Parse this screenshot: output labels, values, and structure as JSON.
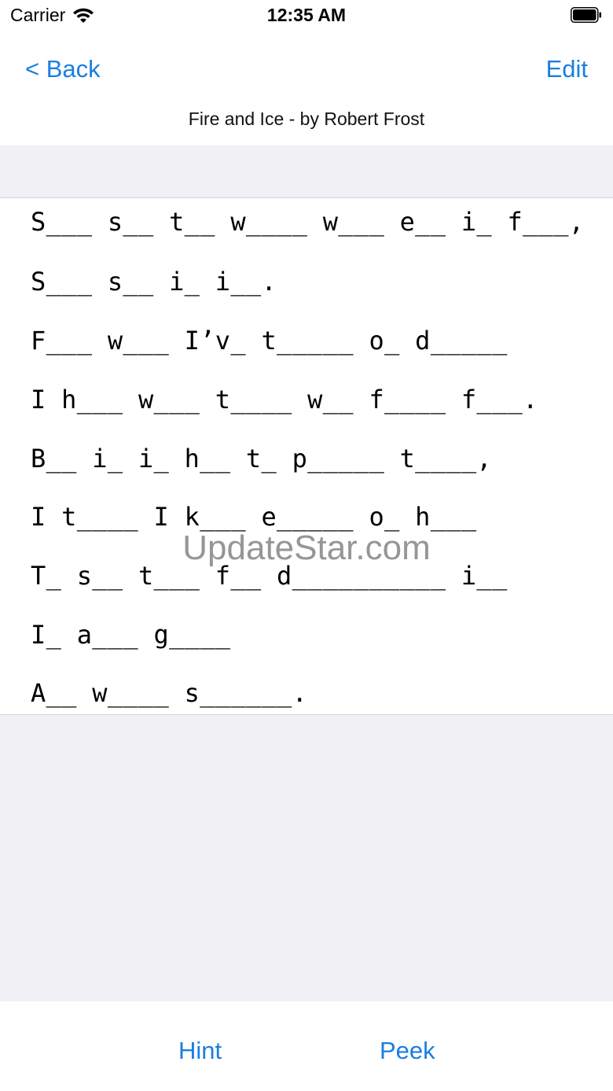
{
  "status_bar": {
    "carrier": "Carrier",
    "time": "12:35 AM",
    "wifi_icon": "wifi-icon",
    "battery_icon": "battery-icon"
  },
  "nav": {
    "back_label": "< Back",
    "edit_label": "Edit",
    "title": "Fire and Ice - by Robert Frost"
  },
  "poem": {
    "lines": [
      "S___ s__ t__ w____ w___ e__ i_ f___,",
      "S___ s__ i_ i__.",
      "F___ w___ I’v_ t_____ o_ d_____",
      "I h___ w___ t____ w__ f____ f___.",
      "B__ i_ i_ h__ t_ p_____ t____,",
      "I t____ I k___ e_____ o_ h___",
      "T_ s__ t___ f__ d__________ i__",
      "I_ a___ g____",
      "A__ w____ s______."
    ]
  },
  "watermark": "UpdateStar.com",
  "toolbar": {
    "hint_label": "Hint",
    "peek_label": "Peek"
  },
  "colors": {
    "accent": "#1a7ee0",
    "band": "#f0f0f5"
  }
}
